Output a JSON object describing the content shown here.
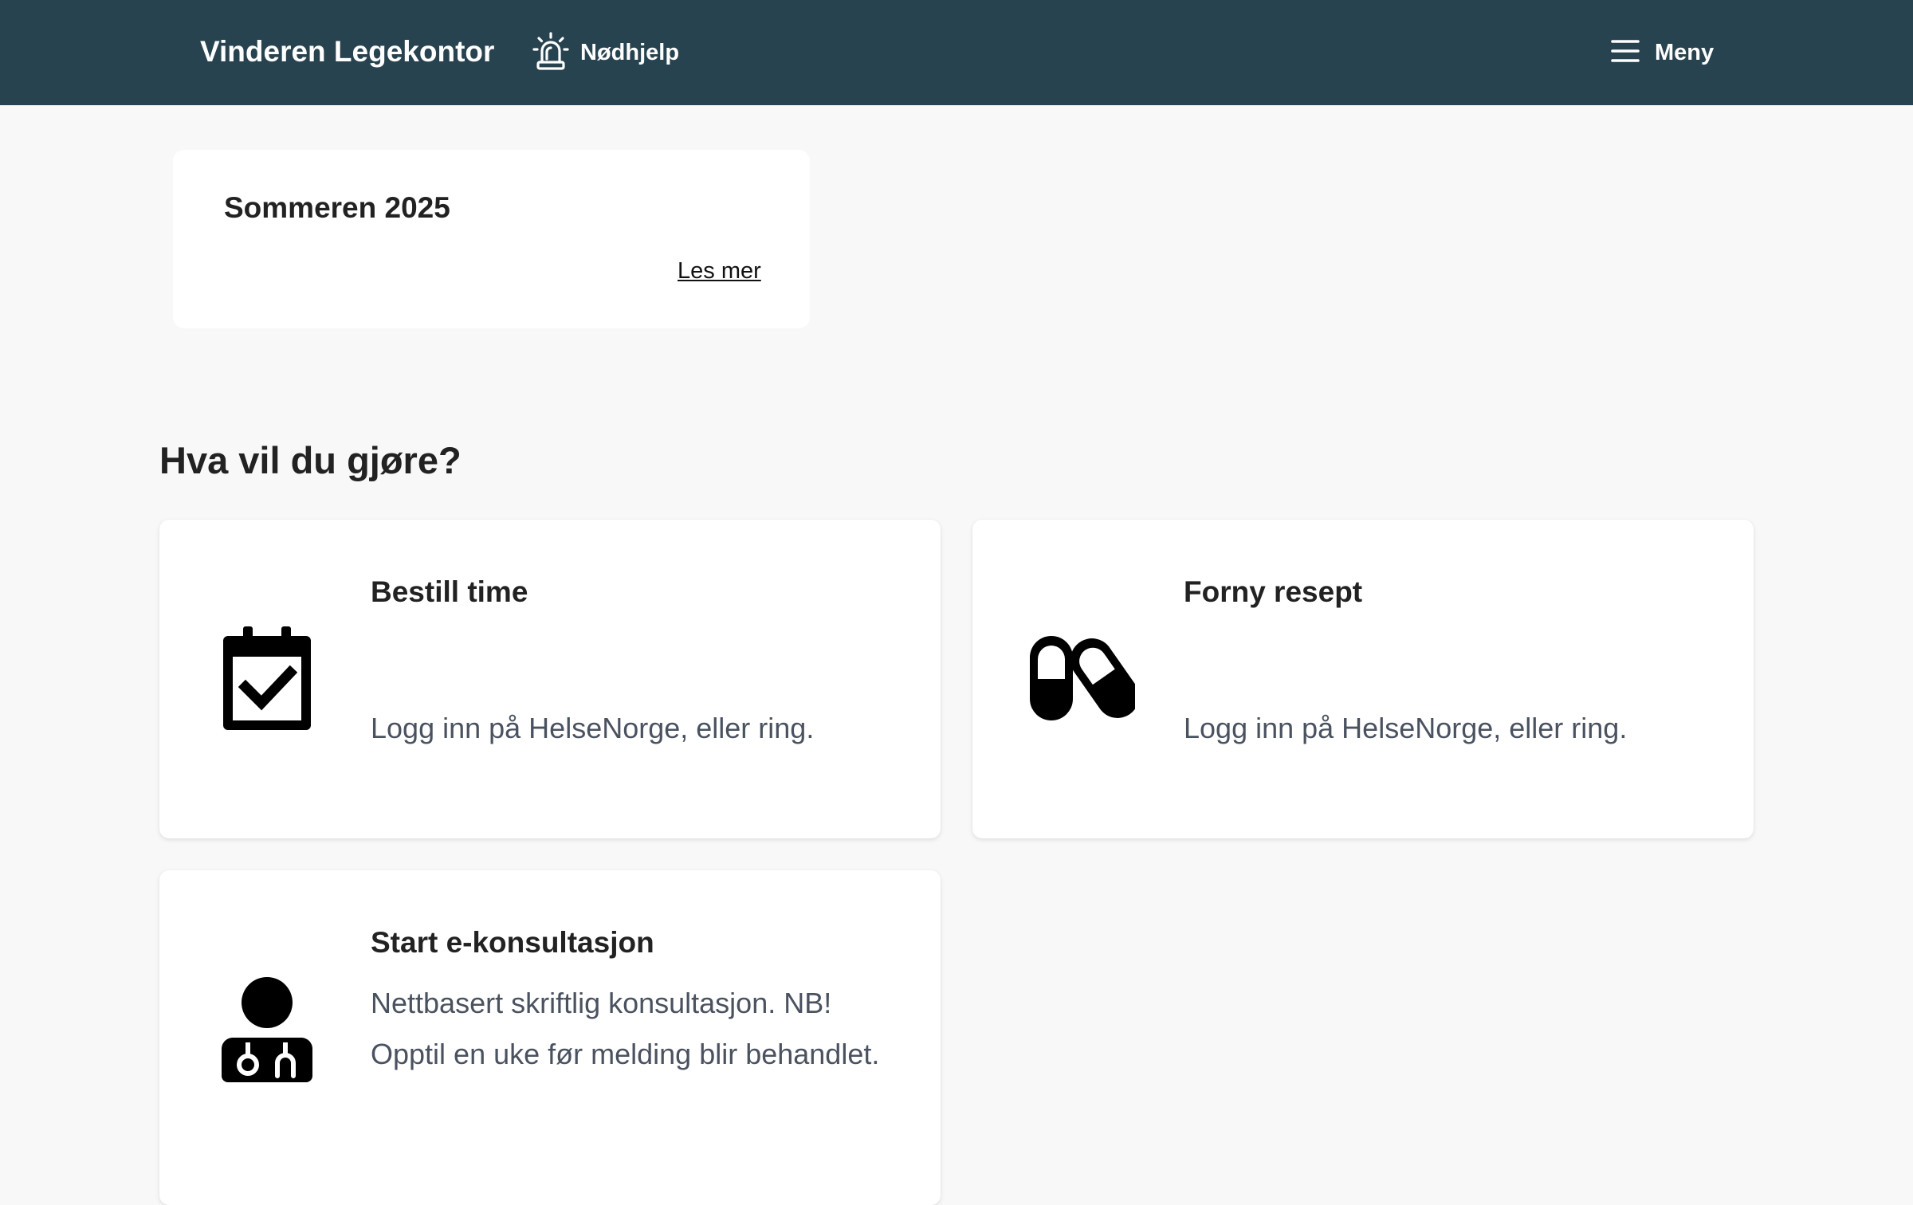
{
  "header": {
    "brand": "Vinderen Legekontor",
    "emergency_label": "Nødhjelp",
    "emergency_icon": "siren-icon",
    "menu_label": "Meny",
    "menu_icon": "hamburger-icon",
    "background": "#284350"
  },
  "notice": {
    "title": "Sommeren 2025",
    "link": "Les mer"
  },
  "section": {
    "title": "Hva vil du gjøre?"
  },
  "cards": [
    {
      "title": "Bestill time",
      "description": "Logg inn på HelseNorge, eller ring.",
      "icon": "calendar-check-icon"
    },
    {
      "title": "Forny resept",
      "description": "Logg inn på HelseNorge, eller ring.",
      "icon": "pills-icon"
    },
    {
      "title": "Start e-konsultasjon",
      "description_lines": [
        "Nettbasert skriftlig konsultasjon. NB!",
        "Opptil en uke før melding blir behandlet."
      ],
      "icon": "doctor-icon"
    }
  ]
}
